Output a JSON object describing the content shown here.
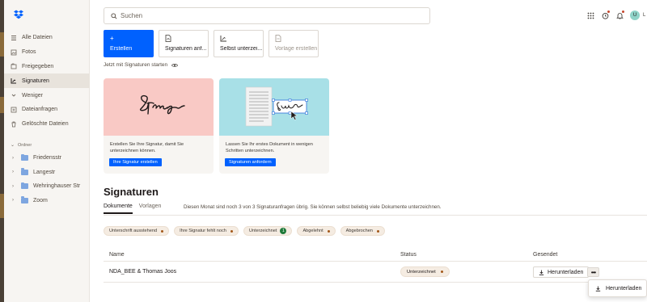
{
  "colors": {
    "accent": "#0061fe",
    "sidebar_bg": "#f7f5f2",
    "card_pink": "#f9c9c5",
    "card_cyan": "#a8e0e7",
    "chip_bg": "#f5ece2",
    "status_dot": "#a3581a",
    "count_badge": "#1f7a3a"
  },
  "sidebar": {
    "logo_icon": "dropbox-logo",
    "items": [
      {
        "label": "Alle Dateien",
        "icon": "files-icon"
      },
      {
        "label": "Fotos",
        "icon": "photos-icon"
      },
      {
        "label": "Freigegeben",
        "icon": "shared-icon"
      },
      {
        "label": "Signaturen",
        "icon": "signature-icon",
        "active": true
      },
      {
        "label": "Weniger",
        "icon": "chevron-down-icon"
      },
      {
        "label": "Dateianfragen",
        "icon": "file-request-icon"
      },
      {
        "label": "Gelöschte Dateien",
        "icon": "trash-icon"
      }
    ],
    "folders_heading": "Ordner",
    "folders": [
      {
        "label": "Friedensstr"
      },
      {
        "label": "Langestr"
      },
      {
        "label": "Wehringhauser Str"
      },
      {
        "label": "Zoom"
      }
    ]
  },
  "search": {
    "placeholder": "Suchen"
  },
  "topbar": {
    "icons": [
      "apps-grid-icon",
      "activity-icon",
      "bell-icon"
    ],
    "avatar_initial": "U",
    "avatar_cut": "L"
  },
  "actions": [
    {
      "label": "Erstellen",
      "icon": "plus-icon",
      "primary": true
    },
    {
      "label": "Signaturen anf...",
      "icon": "signature-request-icon"
    },
    {
      "label": "Selbst unterzei...",
      "icon": "sign-self-icon"
    },
    {
      "label": "Vorlage erstellen",
      "icon": "template-icon",
      "disabled": true
    }
  ],
  "start_hint": "Jetzt mit Signaturen starten",
  "cards": [
    {
      "desc": "Erstellen Sie Ihre Signatur, damit Sie unterzeichnen können.",
      "button": "Ihre Signatur erstellen"
    },
    {
      "desc": "Lassen Sie Ihr erstes Dokument in wenigen Schritten unterzeichnen.",
      "button": "Signaturen anfordern"
    }
  ],
  "signatures": {
    "title": "Signaturen",
    "tabs": [
      "Dokumente",
      "Vorlagen"
    ],
    "quota_text": "Diesen Monat sind noch 3 von 3 Signaturanfragen übrig. Sie können selbst beliebig viele Dokumente unterzeichnen.",
    "filters": [
      {
        "label": "Unterschrift ausstehend"
      },
      {
        "label": "Ihre Signatur fehlt noch"
      },
      {
        "label": "Unterzeichnet",
        "count": "1"
      },
      {
        "label": "Abgelehnt"
      },
      {
        "label": "Abgebrochen"
      }
    ],
    "columns": {
      "name": "Name",
      "status": "Status",
      "sent": "Gesendet"
    },
    "rows": [
      {
        "name": "NDA_BEE & Thomas Joos",
        "status": "Unterzeichnet",
        "download": "Herunterladen"
      }
    ],
    "menu": {
      "download": "Herunterladen"
    }
  }
}
